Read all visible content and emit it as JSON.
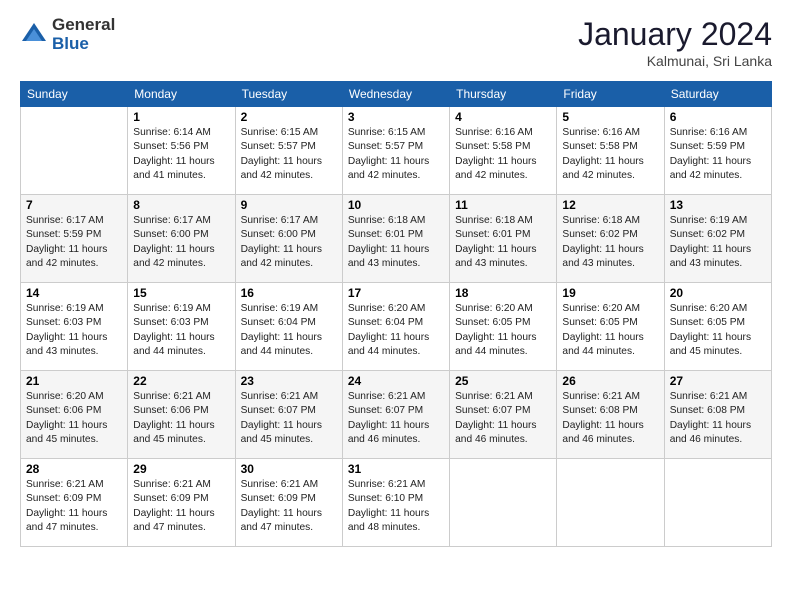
{
  "header": {
    "logo_general": "General",
    "logo_blue": "Blue",
    "month_title": "January 2024",
    "location": "Kalmunai, Sri Lanka"
  },
  "weekdays": [
    "Sunday",
    "Monday",
    "Tuesday",
    "Wednesday",
    "Thursday",
    "Friday",
    "Saturday"
  ],
  "weeks": [
    [
      {
        "day": "",
        "info": ""
      },
      {
        "day": "1",
        "info": "Sunrise: 6:14 AM\nSunset: 5:56 PM\nDaylight: 11 hours\nand 41 minutes."
      },
      {
        "day": "2",
        "info": "Sunrise: 6:15 AM\nSunset: 5:57 PM\nDaylight: 11 hours\nand 42 minutes."
      },
      {
        "day": "3",
        "info": "Sunrise: 6:15 AM\nSunset: 5:57 PM\nDaylight: 11 hours\nand 42 minutes."
      },
      {
        "day": "4",
        "info": "Sunrise: 6:16 AM\nSunset: 5:58 PM\nDaylight: 11 hours\nand 42 minutes."
      },
      {
        "day": "5",
        "info": "Sunrise: 6:16 AM\nSunset: 5:58 PM\nDaylight: 11 hours\nand 42 minutes."
      },
      {
        "day": "6",
        "info": "Sunrise: 6:16 AM\nSunset: 5:59 PM\nDaylight: 11 hours\nand 42 minutes."
      }
    ],
    [
      {
        "day": "7",
        "info": "Sunrise: 6:17 AM\nSunset: 5:59 PM\nDaylight: 11 hours\nand 42 minutes."
      },
      {
        "day": "8",
        "info": "Sunrise: 6:17 AM\nSunset: 6:00 PM\nDaylight: 11 hours\nand 42 minutes."
      },
      {
        "day": "9",
        "info": "Sunrise: 6:17 AM\nSunset: 6:00 PM\nDaylight: 11 hours\nand 42 minutes."
      },
      {
        "day": "10",
        "info": "Sunrise: 6:18 AM\nSunset: 6:01 PM\nDaylight: 11 hours\nand 43 minutes."
      },
      {
        "day": "11",
        "info": "Sunrise: 6:18 AM\nSunset: 6:01 PM\nDaylight: 11 hours\nand 43 minutes."
      },
      {
        "day": "12",
        "info": "Sunrise: 6:18 AM\nSunset: 6:02 PM\nDaylight: 11 hours\nand 43 minutes."
      },
      {
        "day": "13",
        "info": "Sunrise: 6:19 AM\nSunset: 6:02 PM\nDaylight: 11 hours\nand 43 minutes."
      }
    ],
    [
      {
        "day": "14",
        "info": "Sunrise: 6:19 AM\nSunset: 6:03 PM\nDaylight: 11 hours\nand 43 minutes."
      },
      {
        "day": "15",
        "info": "Sunrise: 6:19 AM\nSunset: 6:03 PM\nDaylight: 11 hours\nand 44 minutes."
      },
      {
        "day": "16",
        "info": "Sunrise: 6:19 AM\nSunset: 6:04 PM\nDaylight: 11 hours\nand 44 minutes."
      },
      {
        "day": "17",
        "info": "Sunrise: 6:20 AM\nSunset: 6:04 PM\nDaylight: 11 hours\nand 44 minutes."
      },
      {
        "day": "18",
        "info": "Sunrise: 6:20 AM\nSunset: 6:05 PM\nDaylight: 11 hours\nand 44 minutes."
      },
      {
        "day": "19",
        "info": "Sunrise: 6:20 AM\nSunset: 6:05 PM\nDaylight: 11 hours\nand 44 minutes."
      },
      {
        "day": "20",
        "info": "Sunrise: 6:20 AM\nSunset: 6:05 PM\nDaylight: 11 hours\nand 45 minutes."
      }
    ],
    [
      {
        "day": "21",
        "info": "Sunrise: 6:20 AM\nSunset: 6:06 PM\nDaylight: 11 hours\nand 45 minutes."
      },
      {
        "day": "22",
        "info": "Sunrise: 6:21 AM\nSunset: 6:06 PM\nDaylight: 11 hours\nand 45 minutes."
      },
      {
        "day": "23",
        "info": "Sunrise: 6:21 AM\nSunset: 6:07 PM\nDaylight: 11 hours\nand 45 minutes."
      },
      {
        "day": "24",
        "info": "Sunrise: 6:21 AM\nSunset: 6:07 PM\nDaylight: 11 hours\nand 46 minutes."
      },
      {
        "day": "25",
        "info": "Sunrise: 6:21 AM\nSunset: 6:07 PM\nDaylight: 11 hours\nand 46 minutes."
      },
      {
        "day": "26",
        "info": "Sunrise: 6:21 AM\nSunset: 6:08 PM\nDaylight: 11 hours\nand 46 minutes."
      },
      {
        "day": "27",
        "info": "Sunrise: 6:21 AM\nSunset: 6:08 PM\nDaylight: 11 hours\nand 46 minutes."
      }
    ],
    [
      {
        "day": "28",
        "info": "Sunrise: 6:21 AM\nSunset: 6:09 PM\nDaylight: 11 hours\nand 47 minutes."
      },
      {
        "day": "29",
        "info": "Sunrise: 6:21 AM\nSunset: 6:09 PM\nDaylight: 11 hours\nand 47 minutes."
      },
      {
        "day": "30",
        "info": "Sunrise: 6:21 AM\nSunset: 6:09 PM\nDaylight: 11 hours\nand 47 minutes."
      },
      {
        "day": "31",
        "info": "Sunrise: 6:21 AM\nSunset: 6:10 PM\nDaylight: 11 hours\nand 48 minutes."
      },
      {
        "day": "",
        "info": ""
      },
      {
        "day": "",
        "info": ""
      },
      {
        "day": "",
        "info": ""
      }
    ]
  ]
}
